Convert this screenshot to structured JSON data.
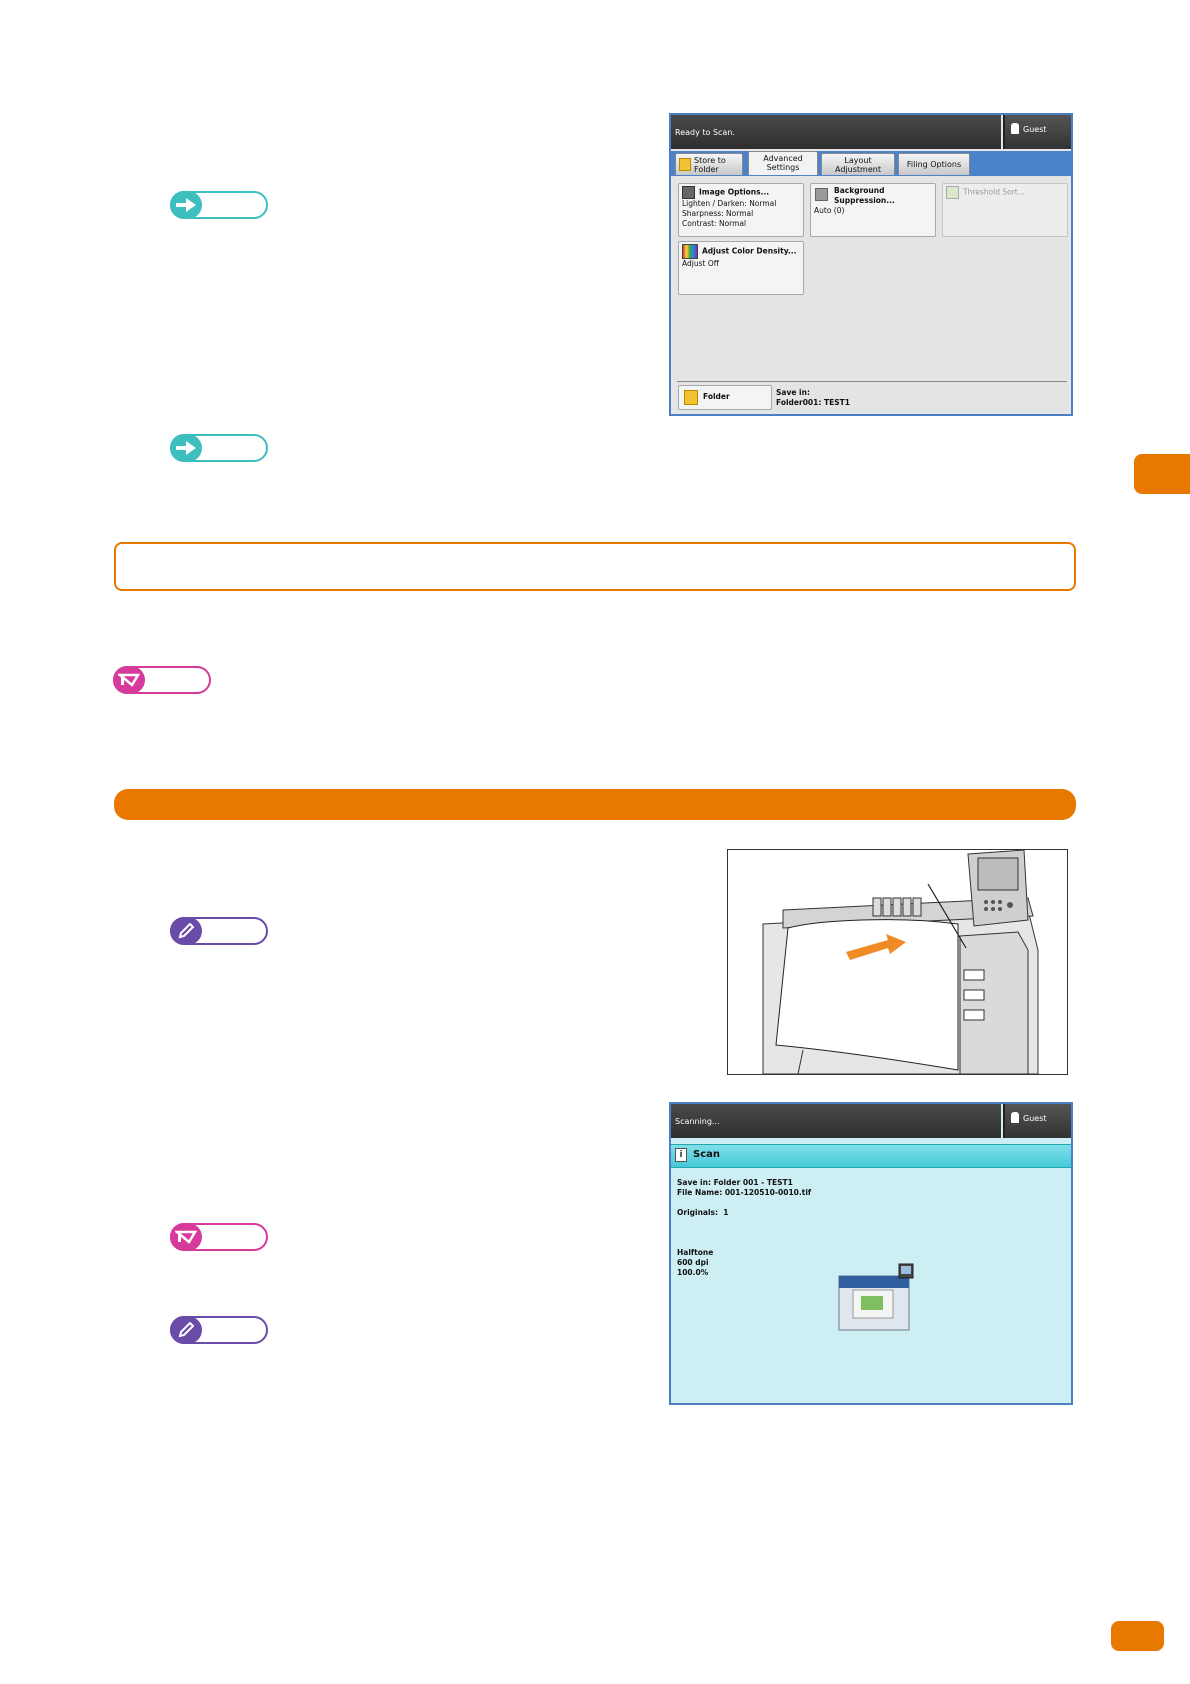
{
  "screen1": {
    "status": "Ready to Scan.",
    "user": "Guest",
    "tabs": [
      {
        "line1": "Store to",
        "line2": "Folder"
      },
      {
        "line1": "Advanced",
        "line2": "Settings"
      },
      {
        "line1": "Layout",
        "line2": "Adjustment"
      },
      {
        "line1": "Filing Options",
        "line2": ""
      }
    ],
    "buttons": {
      "image_options": {
        "title": "Image Options...",
        "l1": "Lighten / Darken: Normal",
        "l2": "Sharpness: Normal",
        "l3": "Contrast: Normal"
      },
      "background": {
        "title1": "Background",
        "title2": "Suppression...",
        "value": "Auto (0)"
      },
      "threshold": {
        "title": "Threshold Sort..."
      },
      "color_density": {
        "title": "Adjust Color Density...",
        "value": "Adjust Off"
      }
    },
    "folder_button": "Folder",
    "save_in_label": "Save in:",
    "save_in_value": "Folder001: TEST1"
  },
  "screen2": {
    "status": "Scanning...",
    "user": "Guest",
    "title": "Scan",
    "save_in": "Save in: Folder 001 - TEST1",
    "file_name": "File Name: 001-120510-0010.tif",
    "originals_label": "Originals:",
    "originals_value": "1",
    "mode": "Halftone",
    "resolution": "600 dpi",
    "zoom": "100.0%"
  },
  "colors": {
    "accent": "#e87800",
    "teal": "#3dbfbf",
    "magenta": "#d63a9a",
    "purple": "#6a4ba8",
    "screen_border": "#4a7fc4",
    "scan_bg": "#cdeef2"
  }
}
